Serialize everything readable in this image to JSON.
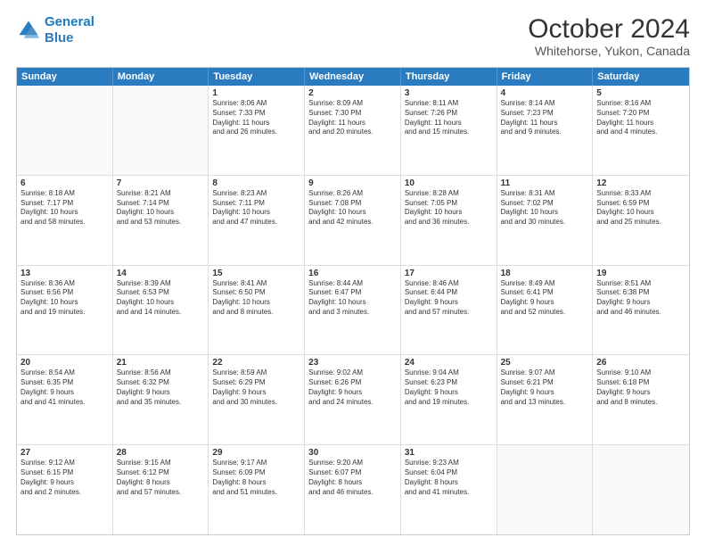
{
  "logo": {
    "line1": "General",
    "line2": "Blue"
  },
  "title": "October 2024",
  "location": "Whitehorse, Yukon, Canada",
  "header_days": [
    "Sunday",
    "Monday",
    "Tuesday",
    "Wednesday",
    "Thursday",
    "Friday",
    "Saturday"
  ],
  "weeks": [
    [
      {
        "day": "",
        "sunrise": "",
        "sunset": "",
        "daylight": "",
        "empty": true
      },
      {
        "day": "",
        "sunrise": "",
        "sunset": "",
        "daylight": "",
        "empty": true
      },
      {
        "day": "1",
        "sunrise": "Sunrise: 8:06 AM",
        "sunset": "Sunset: 7:33 PM",
        "daylight": "Daylight: 11 hours and 26 minutes."
      },
      {
        "day": "2",
        "sunrise": "Sunrise: 8:09 AM",
        "sunset": "Sunset: 7:30 PM",
        "daylight": "Daylight: 11 hours and 20 minutes."
      },
      {
        "day": "3",
        "sunrise": "Sunrise: 8:11 AM",
        "sunset": "Sunset: 7:26 PM",
        "daylight": "Daylight: 11 hours and 15 minutes."
      },
      {
        "day": "4",
        "sunrise": "Sunrise: 8:14 AM",
        "sunset": "Sunset: 7:23 PM",
        "daylight": "Daylight: 11 hours and 9 minutes."
      },
      {
        "day": "5",
        "sunrise": "Sunrise: 8:16 AM",
        "sunset": "Sunset: 7:20 PM",
        "daylight": "Daylight: 11 hours and 4 minutes."
      }
    ],
    [
      {
        "day": "6",
        "sunrise": "Sunrise: 8:18 AM",
        "sunset": "Sunset: 7:17 PM",
        "daylight": "Daylight: 10 hours and 58 minutes."
      },
      {
        "day": "7",
        "sunrise": "Sunrise: 8:21 AM",
        "sunset": "Sunset: 7:14 PM",
        "daylight": "Daylight: 10 hours and 53 minutes."
      },
      {
        "day": "8",
        "sunrise": "Sunrise: 8:23 AM",
        "sunset": "Sunset: 7:11 PM",
        "daylight": "Daylight: 10 hours and 47 minutes."
      },
      {
        "day": "9",
        "sunrise": "Sunrise: 8:26 AM",
        "sunset": "Sunset: 7:08 PM",
        "daylight": "Daylight: 10 hours and 42 minutes."
      },
      {
        "day": "10",
        "sunrise": "Sunrise: 8:28 AM",
        "sunset": "Sunset: 7:05 PM",
        "daylight": "Daylight: 10 hours and 36 minutes."
      },
      {
        "day": "11",
        "sunrise": "Sunrise: 8:31 AM",
        "sunset": "Sunset: 7:02 PM",
        "daylight": "Daylight: 10 hours and 30 minutes."
      },
      {
        "day": "12",
        "sunrise": "Sunrise: 8:33 AM",
        "sunset": "Sunset: 6:59 PM",
        "daylight": "Daylight: 10 hours and 25 minutes."
      }
    ],
    [
      {
        "day": "13",
        "sunrise": "Sunrise: 8:36 AM",
        "sunset": "Sunset: 6:56 PM",
        "daylight": "Daylight: 10 hours and 19 minutes."
      },
      {
        "day": "14",
        "sunrise": "Sunrise: 8:39 AM",
        "sunset": "Sunset: 6:53 PM",
        "daylight": "Daylight: 10 hours and 14 minutes."
      },
      {
        "day": "15",
        "sunrise": "Sunrise: 8:41 AM",
        "sunset": "Sunset: 6:50 PM",
        "daylight": "Daylight: 10 hours and 8 minutes."
      },
      {
        "day": "16",
        "sunrise": "Sunrise: 8:44 AM",
        "sunset": "Sunset: 6:47 PM",
        "daylight": "Daylight: 10 hours and 3 minutes."
      },
      {
        "day": "17",
        "sunrise": "Sunrise: 8:46 AM",
        "sunset": "Sunset: 6:44 PM",
        "daylight": "Daylight: 9 hours and 57 minutes."
      },
      {
        "day": "18",
        "sunrise": "Sunrise: 8:49 AM",
        "sunset": "Sunset: 6:41 PM",
        "daylight": "Daylight: 9 hours and 52 minutes."
      },
      {
        "day": "19",
        "sunrise": "Sunrise: 8:51 AM",
        "sunset": "Sunset: 6:38 PM",
        "daylight": "Daylight: 9 hours and 46 minutes."
      }
    ],
    [
      {
        "day": "20",
        "sunrise": "Sunrise: 8:54 AM",
        "sunset": "Sunset: 6:35 PM",
        "daylight": "Daylight: 9 hours and 41 minutes."
      },
      {
        "day": "21",
        "sunrise": "Sunrise: 8:56 AM",
        "sunset": "Sunset: 6:32 PM",
        "daylight": "Daylight: 9 hours and 35 minutes."
      },
      {
        "day": "22",
        "sunrise": "Sunrise: 8:59 AM",
        "sunset": "Sunset: 6:29 PM",
        "daylight": "Daylight: 9 hours and 30 minutes."
      },
      {
        "day": "23",
        "sunrise": "Sunrise: 9:02 AM",
        "sunset": "Sunset: 6:26 PM",
        "daylight": "Daylight: 9 hours and 24 minutes."
      },
      {
        "day": "24",
        "sunrise": "Sunrise: 9:04 AM",
        "sunset": "Sunset: 6:23 PM",
        "daylight": "Daylight: 9 hours and 19 minutes."
      },
      {
        "day": "25",
        "sunrise": "Sunrise: 9:07 AM",
        "sunset": "Sunset: 6:21 PM",
        "daylight": "Daylight: 9 hours and 13 minutes."
      },
      {
        "day": "26",
        "sunrise": "Sunrise: 9:10 AM",
        "sunset": "Sunset: 6:18 PM",
        "daylight": "Daylight: 9 hours and 8 minutes."
      }
    ],
    [
      {
        "day": "27",
        "sunrise": "Sunrise: 9:12 AM",
        "sunset": "Sunset: 6:15 PM",
        "daylight": "Daylight: 9 hours and 2 minutes."
      },
      {
        "day": "28",
        "sunrise": "Sunrise: 9:15 AM",
        "sunset": "Sunset: 6:12 PM",
        "daylight": "Daylight: 8 hours and 57 minutes."
      },
      {
        "day": "29",
        "sunrise": "Sunrise: 9:17 AM",
        "sunset": "Sunset: 6:09 PM",
        "daylight": "Daylight: 8 hours and 51 minutes."
      },
      {
        "day": "30",
        "sunrise": "Sunrise: 9:20 AM",
        "sunset": "Sunset: 6:07 PM",
        "daylight": "Daylight: 8 hours and 46 minutes."
      },
      {
        "day": "31",
        "sunrise": "Sunrise: 9:23 AM",
        "sunset": "Sunset: 6:04 PM",
        "daylight": "Daylight: 8 hours and 41 minutes."
      },
      {
        "day": "",
        "sunrise": "",
        "sunset": "",
        "daylight": "",
        "empty": true
      },
      {
        "day": "",
        "sunrise": "",
        "sunset": "",
        "daylight": "",
        "empty": true
      }
    ]
  ]
}
